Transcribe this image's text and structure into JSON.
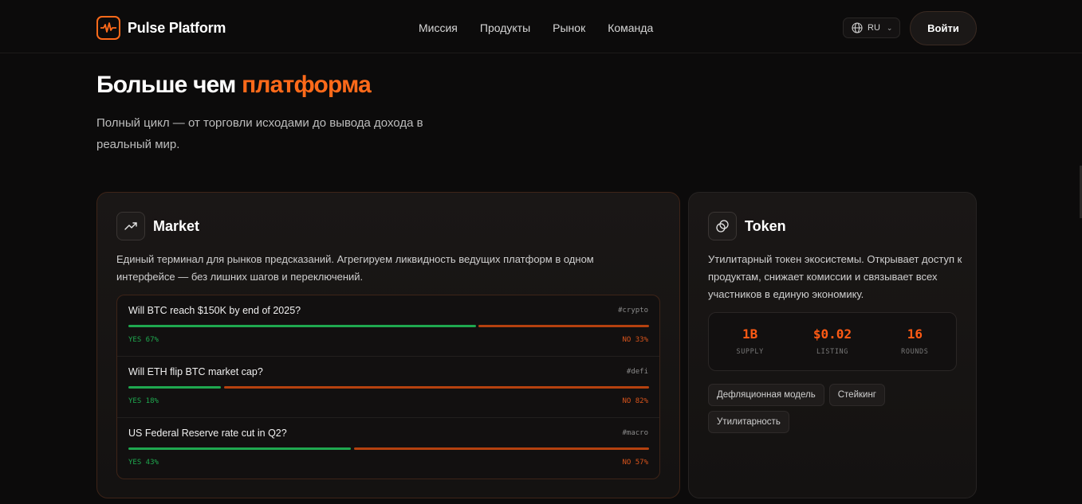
{
  "brand": {
    "name": "Pulse Platform",
    "accent": "#ff6a1a"
  },
  "nav": {
    "items": [
      "Миссия",
      "Продукты",
      "Рынок",
      "Команда"
    ]
  },
  "header": {
    "lang": "RU",
    "login": "Войти"
  },
  "hero": {
    "title_main": "Больше чем ",
    "title_accent": "платформа",
    "subtitle": "Полный цикл — от торговли исходами до вывода дохода в реальный мир."
  },
  "market": {
    "title": "Market",
    "desc": "Единый терминал для рынков предсказаний. Агрегируем ликвидность ведущих платформ в одном интерфейсе — без лишних шагов и переключений.",
    "rows": [
      {
        "question": "Will BTC reach $150K by end of 2025?",
        "tag": "#crypto",
        "yes": 67,
        "no": 33,
        "yes_label": "YES 67%",
        "no_label": "NO 33%"
      },
      {
        "question": "Will ETH flip BTC market cap?",
        "tag": "#defi",
        "yes": 18,
        "no": 82,
        "yes_label": "YES 18%",
        "no_label": "NO 82%"
      },
      {
        "question": "US Federal Reserve rate cut in Q2?",
        "tag": "#macro",
        "yes": 43,
        "no": 57,
        "yes_label": "YES 43%",
        "no_label": "NO 57%"
      }
    ]
  },
  "token": {
    "title": "Token",
    "desc": "Утилитарный токен экосистемы. Открывает доступ к продуктам, снижает комиссии и связывает всех участников в единую экономику.",
    "stats": [
      {
        "value": "1B",
        "label": "SUPPLY"
      },
      {
        "value": "$0.02",
        "label": "LISTING"
      },
      {
        "value": "16",
        "label": "ROUNDS"
      }
    ],
    "chips": [
      "Дефляционная модель",
      "Стейкинг",
      "Утилитарность"
    ]
  }
}
